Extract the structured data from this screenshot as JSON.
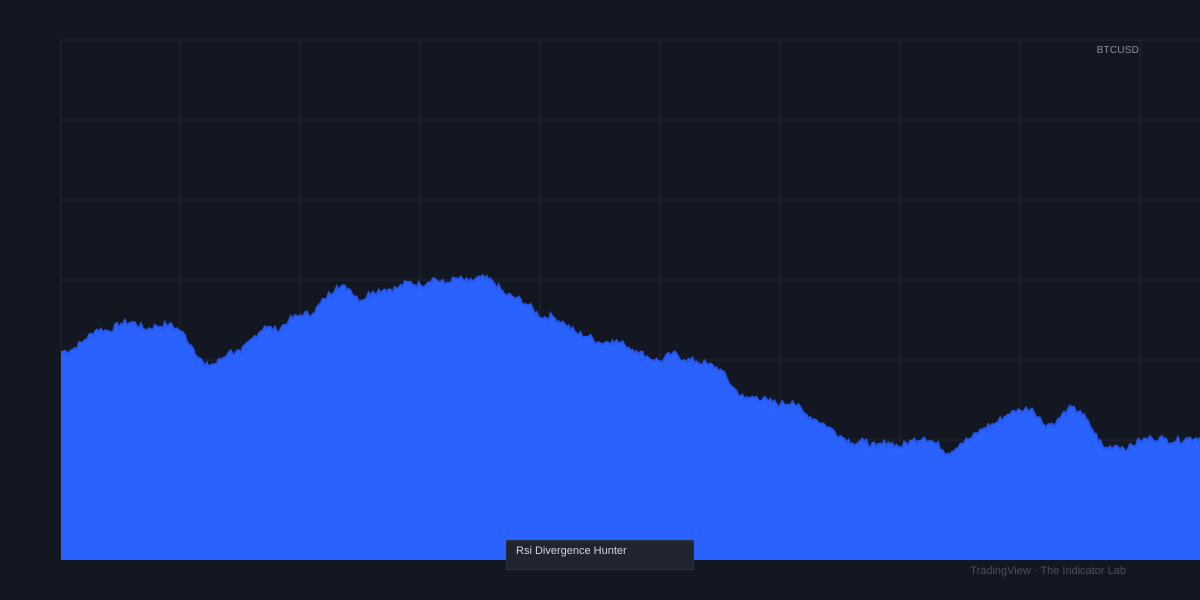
{
  "symbol": "BTCUSD",
  "indicator_label": "Rsi Divergence Hunter",
  "footer": "TradingView · The Indicator Lab",
  "colors": {
    "background": "#131722",
    "grid": "#232735",
    "area": "#2962ff"
  },
  "chart_data": {
    "type": "area",
    "title": "",
    "xlabel": "",
    "ylabel": "",
    "grid": true,
    "xlim": [
      0,
      95
    ],
    "ylim": [
      0,
      65
    ],
    "series": [
      {
        "values": [
          26,
          26.3,
          27.5,
          28.8,
          28.6,
          29.5,
          29.7,
          28.8,
          29.2,
          29.4,
          28.6,
          26.5,
          24.2,
          24.6,
          26,
          25.9,
          27.7,
          29.2,
          28.6,
          29.9,
          30.6,
          30.8,
          32.6,
          34.2,
          33.9,
          32.4,
          33.5,
          33.8,
          33.9,
          34.7,
          34.3,
          35.2,
          34.5,
          35.2,
          34.7,
          35.3,
          34.8,
          33.2,
          32.7,
          31.8,
          30.3,
          30.4,
          29.5,
          28.3,
          27.9,
          27.1,
          27.4,
          26.9,
          26.1,
          25.3,
          24.8,
          25.8,
          25,
          24.8,
          24.4,
          23.8,
          21.6,
          20.1,
          20.4,
          19.8,
          19.4,
          19.8,
          18.3,
          17.5,
          16.6,
          15.5,
          14.6,
          14.8,
          14.1,
          14.7,
          14.1,
          14.9,
          15.3,
          14.5,
          13.3,
          14.5,
          15.3,
          16.5,
          17.1,
          18.2,
          18.7,
          18.9,
          16.9,
          17.1,
          18.9,
          18.6,
          16.3,
          13.9,
          14.3,
          13.9,
          14.9,
          15.2,
          15.1,
          14.8,
          15.2,
          15.3
        ]
      }
    ]
  }
}
